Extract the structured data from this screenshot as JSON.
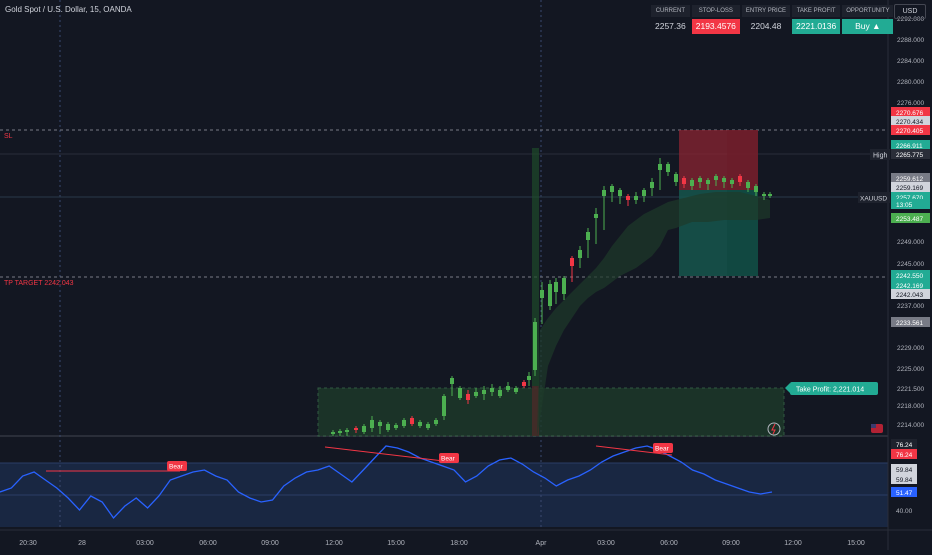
{
  "symbol_title": "Gold Spot / U.S. Dollar, 15, OANDA",
  "currency": "USD",
  "trade_panel": {
    "current": {
      "label": "CURRENT",
      "value": "2257.36"
    },
    "stop_loss": {
      "label": "STOP-LOSS",
      "value": "2193.4576"
    },
    "entry": {
      "label": "ENTRY PRICE",
      "value": "2204.48"
    },
    "take_profit": {
      "label": "TAKE PROFIT",
      "value": "2221.0136"
    },
    "opportunity": {
      "label": "OPPORTUNITY",
      "value": "Buy ▲"
    }
  },
  "price_axis": {
    "ticks": [
      "2292.000",
      "2288.000",
      "2284.000",
      "2280.000",
      "2276.000",
      "2272.000",
      "2249.000",
      "2245.000",
      "2237.000",
      "2229.000",
      "2225.000",
      "2221.500",
      "2218.000",
      "2214.000"
    ],
    "tags": [
      {
        "text": "2270.676",
        "color": "#f23645"
      },
      {
        "text": "2270.434",
        "color": "#d1d4dc"
      },
      {
        "text": "2270.405",
        "color": "#f23645"
      },
      {
        "text": "2266.911",
        "color": "#22ab94"
      },
      {
        "text": "2265.775",
        "color": "#2a2e39"
      },
      {
        "text": "2259.612",
        "color": "#787b86"
      },
      {
        "text": "2259.169",
        "color": "#d1d4dc"
      },
      {
        "text": "2257.670",
        "color": "#22ab94"
      },
      {
        "text": "13:05",
        "color": "#22ab94"
      },
      {
        "text": "2253.487",
        "color": "#4caf50"
      },
      {
        "text": "2242.550",
        "color": "#22ab94"
      },
      {
        "text": "2242.169",
        "color": "#22ab94"
      },
      {
        "text": "2242.043",
        "color": "#d1d4dc"
      },
      {
        "text": "2233.561",
        "color": "#787b86"
      }
    ],
    "high_label": "High",
    "symbol_label": "XAUUSD"
  },
  "labels": {
    "sl": "SL",
    "tp_target": "TP TARGET 2242.043",
    "take_profit_note": "Take Profit: 2,221.014"
  },
  "indicator": {
    "divergence_label": "Bear",
    "axis_ticks": [
      "76.24",
      "76.24",
      "59.84",
      "59.84",
      "51.47",
      "40.00"
    ]
  },
  "time_axis": {
    "labels": [
      "20:30",
      "28",
      "03:00",
      "06:00",
      "09:00",
      "12:00",
      "15:00",
      "18:00",
      "Apr",
      "03:00",
      "06:00",
      "09:00",
      "12:00",
      "15:00"
    ]
  },
  "colors": {
    "background": "#131722",
    "bull": "#4caf50",
    "bear": "#f23645",
    "rsi_line": "#2962ff",
    "grid": "#1e222d"
  }
}
